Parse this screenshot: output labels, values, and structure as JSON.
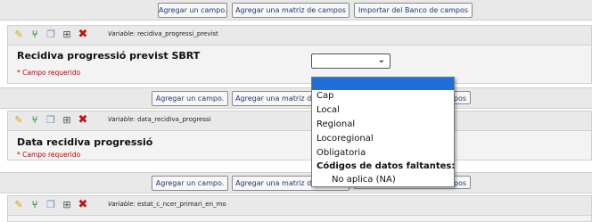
{
  "add_bar": {
    "add_field": "Agregar un campo.",
    "add_matrix": "Agregar una matriz de campos",
    "import_bank": "Importar del Banco de campos"
  },
  "add_bar_partial": {
    "add_matrix_clipped": "Agregar una matriz de",
    "import_clipped": "pos"
  },
  "fields": [
    {
      "variable_prefix": "Variable:",
      "variable": "recidiva_progressi_previst",
      "label": "Recidiva progressió previst SBRT",
      "required": "* Campo requerido"
    },
    {
      "variable_prefix": "Variable:",
      "variable": "data_recidiva_progressi",
      "label": "Data recidiva progressió",
      "required": "* Campo requerido"
    },
    {
      "variable_prefix": "Variable:",
      "variable": "estat_c_ncer_primari_en_mo"
    }
  ],
  "dropdown": {
    "selected": "",
    "options": [
      "",
      "Cap",
      "Local",
      "Regional",
      "Locoregional",
      "Obligatoria"
    ],
    "missing_group": "Códigos de datos faltantes:",
    "missing_options": [
      "No aplica (NA)"
    ]
  },
  "icons": [
    "pencil-icon",
    "branching-icon",
    "copy-icon",
    "add-field-icon",
    "delete-icon",
    "chevron-down-icon"
  ]
}
